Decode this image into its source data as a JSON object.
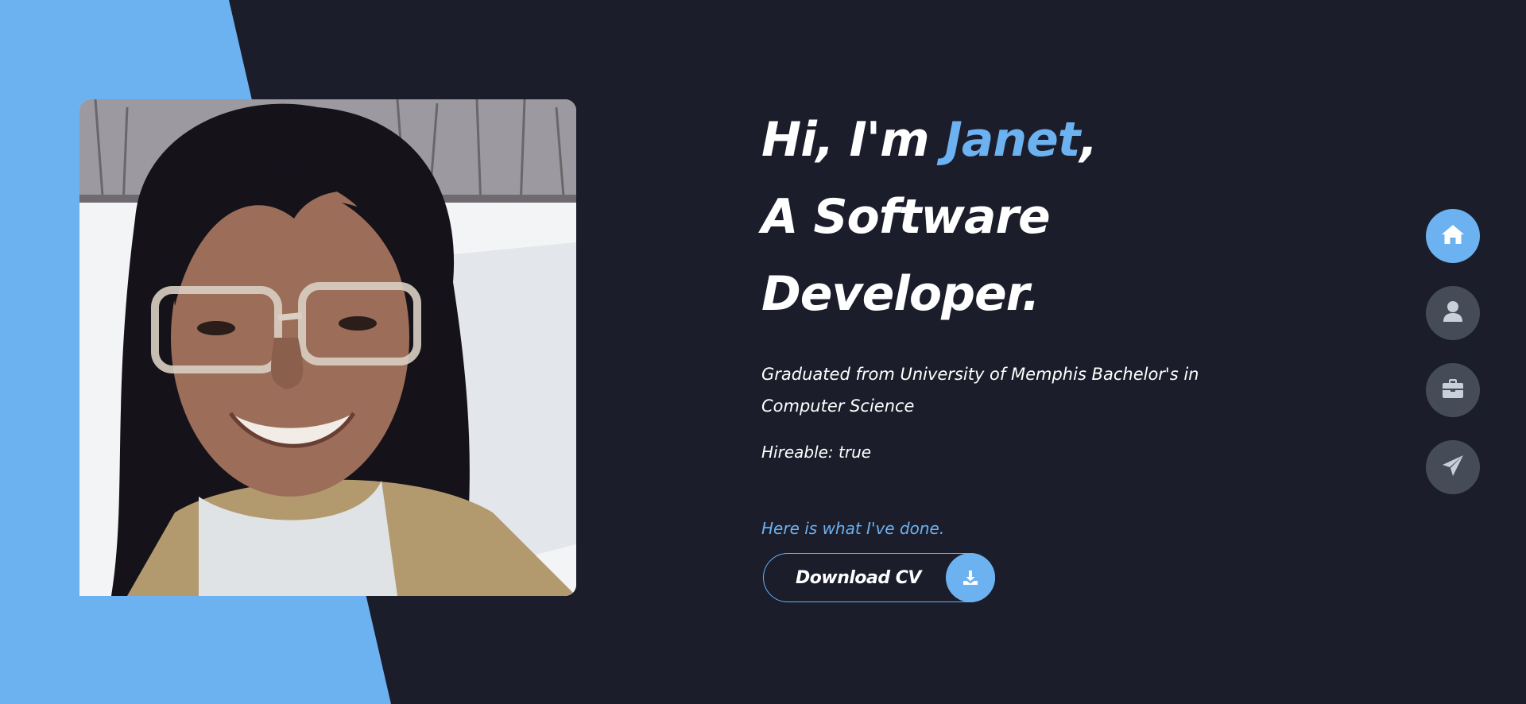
{
  "hero": {
    "greeting_prefix": "Hi, I'm ",
    "name": "Janet",
    "greeting_suffix": ",",
    "title_line1": "A Software",
    "title_line2": "Developer.",
    "bio_line1": "Graduated from University of Memphis Bachelor's in",
    "bio_line2": "Computer Science",
    "hireable": "Hireable: true",
    "portfolio_link": "Here is what I've done.",
    "cv_button_label": "Download CV",
    "cv_button_icon": "download-icon"
  },
  "side_nav": [
    {
      "icon": "home-icon",
      "active": true
    },
    {
      "icon": "user-icon",
      "active": false
    },
    {
      "icon": "briefcase-icon",
      "active": false
    },
    {
      "icon": "send-icon",
      "active": false
    }
  ],
  "colors": {
    "background": "#1b1d2b",
    "accent": "#6cb1f0",
    "nav_inactive": "#454c58",
    "text": "#ffffff"
  }
}
